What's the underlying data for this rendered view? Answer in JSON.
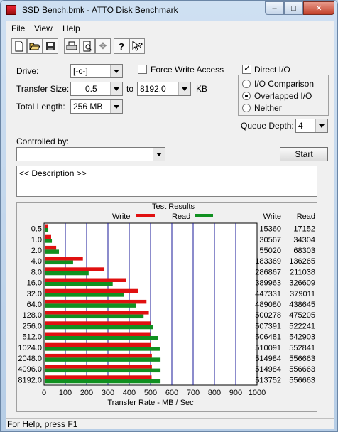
{
  "window": {
    "title": "SSD Bench.bmk - ATTO Disk Benchmark",
    "minimize": "–",
    "maximize": "□",
    "close": "✕"
  },
  "menu": {
    "file": "File",
    "view": "View",
    "help": "Help"
  },
  "toolbar": [
    "new-icon",
    "open-icon",
    "save-icon",
    "print-icon",
    "print-preview-icon",
    "move-icon",
    "help-icon",
    "context-help-icon"
  ],
  "form": {
    "drive_label": "Drive:",
    "drive_value": "[-c-]",
    "force_write": "Force Write Access",
    "force_write_checked": false,
    "direct_io": "Direct I/O",
    "direct_io_checked": true,
    "transfer_size_label": "Transfer Size:",
    "transfer_from": "0.5",
    "to_label": "to",
    "transfer_to": "8192.0",
    "kb_label": "KB",
    "total_length_label": "Total Length:",
    "total_length": "256 MB",
    "io_comparison": "I/O Comparison",
    "overlapped_io": "Overlapped I/O",
    "neither": "Neither",
    "selected_mode": "Overlapped I/O",
    "queue_depth_label": "Queue Depth:",
    "queue_depth": "4",
    "controlled_by_label": "Controlled by:",
    "controlled_by": "",
    "start_button": "Start",
    "description": "<< Description >>"
  },
  "results": {
    "title": "Test Results",
    "write_legend": "Write",
    "read_legend": "Read",
    "write_col": "Write",
    "read_col": "Read",
    "write_values": [
      "15360",
      "30567",
      "55020",
      "183369",
      "286867",
      "389963",
      "447331",
      "489080",
      "500278",
      "507391",
      "506481",
      "510091",
      "514984",
      "514984",
      "513752"
    ],
    "read_values": [
      "17152",
      "34304",
      "68303",
      "136265",
      "211038",
      "326609",
      "379011",
      "438645",
      "475205",
      "522241",
      "542903",
      "552841",
      "556663",
      "556663",
      "556663"
    ]
  },
  "colors": {
    "write": "#e01010",
    "read": "#109020",
    "grid": "#1a1a9a"
  },
  "chart_data": {
    "type": "bar",
    "orientation": "horizontal",
    "title": "Test Results",
    "categories": [
      "0.5",
      "1.0",
      "2.0",
      "4.0",
      "8.0",
      "16.0",
      "32.0",
      "64.0",
      "128.0",
      "256.0",
      "512.0",
      "1024.0",
      "2048.0",
      "4096.0",
      "8192.0"
    ],
    "series": [
      {
        "name": "Write",
        "values": [
          15.0,
          29.9,
          53.7,
          179.1,
          280.1,
          380.8,
          436.8,
          477.6,
          488.6,
          495.5,
          494.6,
          498.1,
          502.9,
          502.9,
          501.7
        ]
      },
      {
        "name": "Read",
        "values": [
          16.8,
          33.5,
          66.7,
          133.1,
          206.1,
          319.0,
          370.1,
          428.4,
          464.1,
          510.0,
          530.2,
          539.9,
          543.6,
          543.6,
          543.6
        ]
      }
    ],
    "xlabel": "Transfer Rate - MB / Sec",
    "xlim": [
      0,
      1000
    ],
    "xticks": [
      "0",
      "100",
      "200",
      "300",
      "400",
      "500",
      "600",
      "700",
      "800",
      "900",
      "1000"
    ],
    "grid": true,
    "legend_position": "top"
  },
  "status": "For Help, press F1"
}
